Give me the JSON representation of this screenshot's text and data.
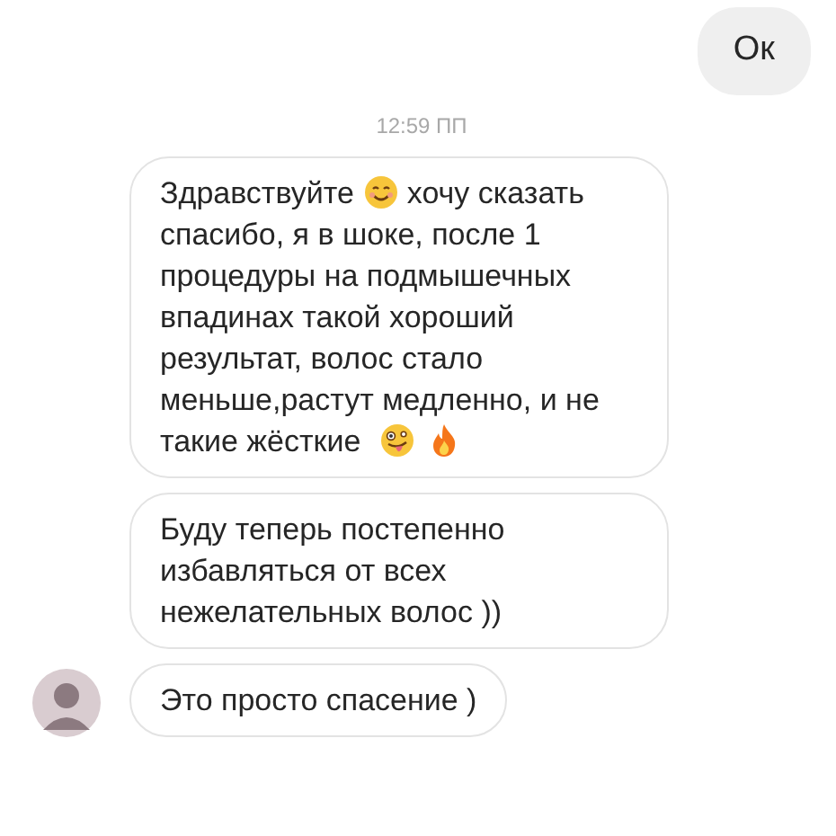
{
  "messages": [
    {
      "kind": "sent",
      "parts": [
        {
          "kind": "text",
          "text": "Ок"
        }
      ]
    },
    {
      "kind": "timestamp",
      "text": "12:59 ПП"
    },
    {
      "kind": "received",
      "avatar": false,
      "parts": [
        {
          "kind": "text",
          "text": "Здравствуйте "
        },
        {
          "kind": "smile"
        },
        {
          "kind": "text",
          "text": " хочу сказать спасибо, я в шоке, после 1 процедуры на подмышечных впадинах такой хороший результат, волос стало меньше,растут медленно, и не такие жёсткие "
        },
        {
          "kind": "silly"
        },
        {
          "kind": "fire"
        }
      ]
    },
    {
      "kind": "received",
      "avatar": false,
      "parts": [
        {
          "kind": "text",
          "text": "Буду теперь постепенно избавляться от всех нежелательных волос ))"
        }
      ]
    },
    {
      "kind": "received",
      "avatar": true,
      "parts": [
        {
          "kind": "text",
          "text": "Это просто спасение )"
        }
      ]
    }
  ]
}
